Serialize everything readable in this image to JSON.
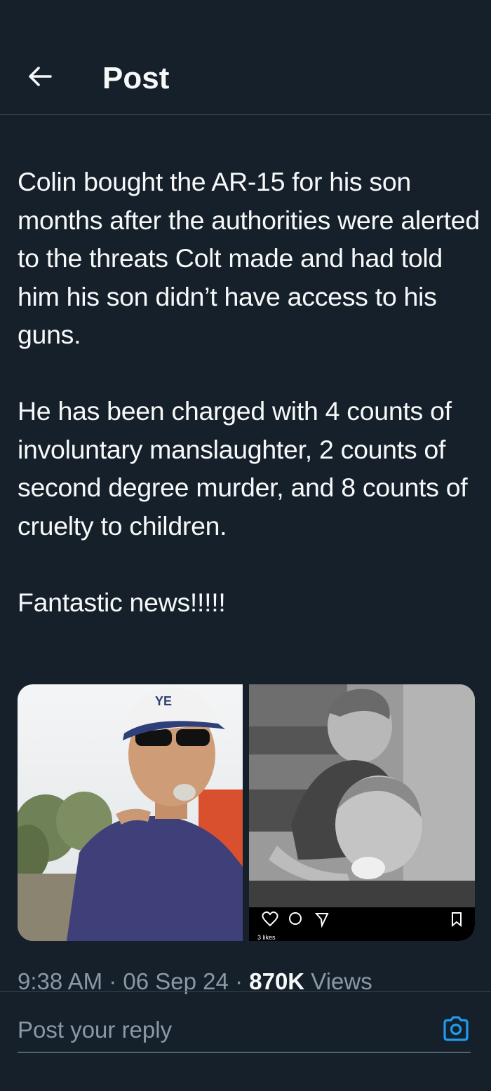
{
  "header": {
    "back_icon": "arrow-left-icon",
    "title": "Post"
  },
  "post": {
    "text": "Colin bought the AR-15 for his son months after the authorities were alerted to the threats Colt made and had told him his son didn’t have access to his guns.\n\nHe has been charged with 4 counts of involuntary manslaughter, 2 counts of second degree murder, and 8 counts of cruelty to children.\n\nFantastic news!!!!!",
    "media": {
      "right_overlay": {
        "icons": [
          "heart-icon",
          "comment-icon",
          "send-icon",
          "bookmark-icon"
        ],
        "likes_text": "3 likes"
      }
    },
    "time": "9:38 AM",
    "separator": "·",
    "date": "06 Sep 24",
    "views_count": "870K",
    "views_label": "Views"
  },
  "reply": {
    "placeholder": "Post your reply",
    "camera_icon": "camera-icon"
  },
  "colors": {
    "background": "#15202b",
    "text": "#f7f9f9",
    "muted": "#8b98a5",
    "accent": "#1d9bf0",
    "border": "#38444d"
  }
}
